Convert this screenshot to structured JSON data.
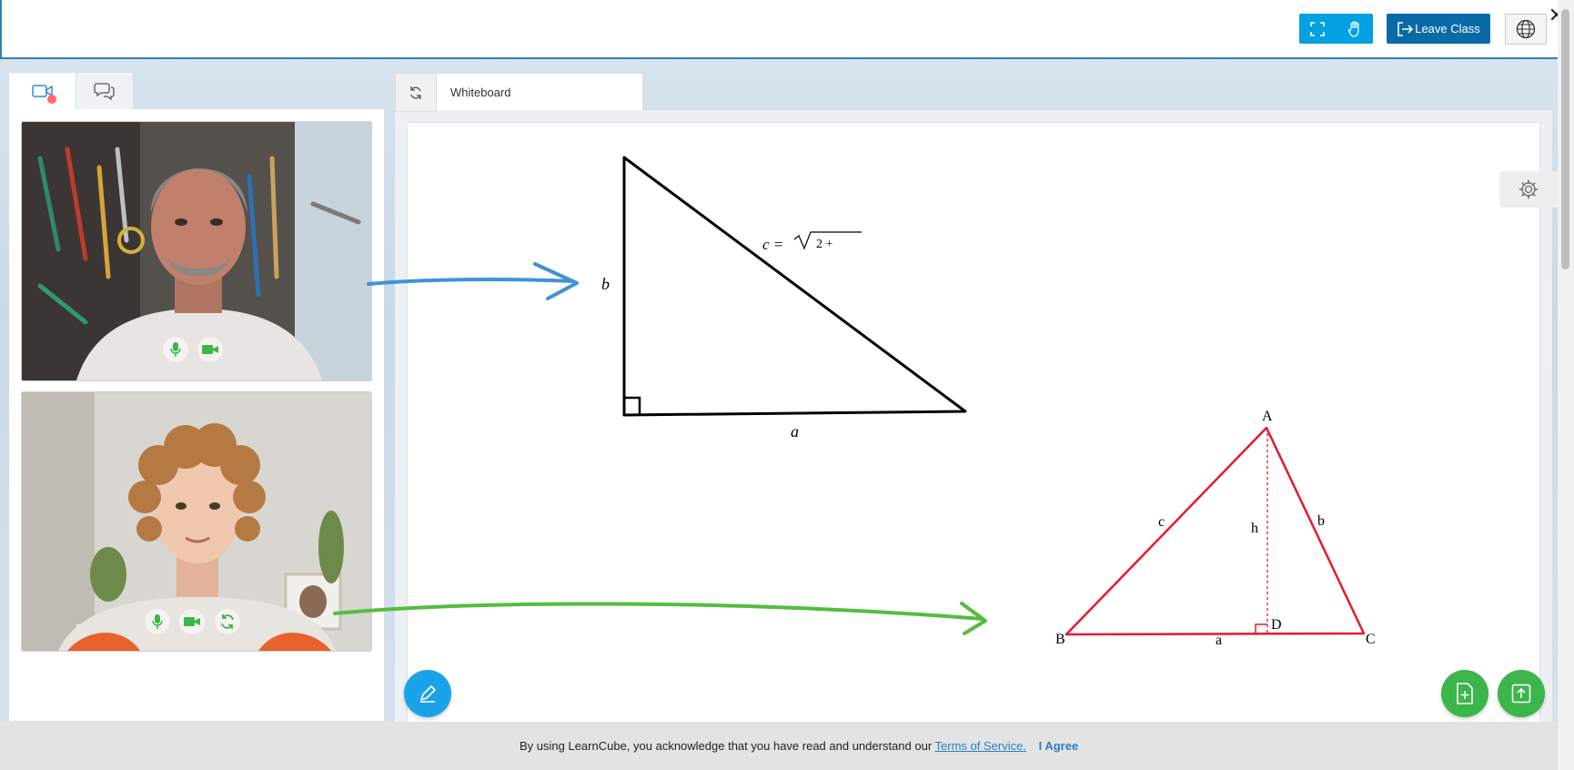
{
  "toolbar": {
    "fullscreen_icon": "fullscreen-icon",
    "raise_hand_icon": "hand-icon",
    "leave_label": "Leave Class",
    "language_icon": "globe-icon",
    "close_icon": "close-icon",
    "accent_color": "#03a0e2",
    "leave_color": "#0a6aa8"
  },
  "left_panel": {
    "tabs": [
      {
        "icon": "video-camera-icon"
      },
      {
        "icon": "chat-icon"
      }
    ],
    "participants": [
      {
        "controls": [
          "mic-icon",
          "camera-icon"
        ]
      },
      {
        "controls": [
          "mic-icon",
          "camera-icon",
          "switch-camera-icon"
        ]
      }
    ]
  },
  "whiteboard": {
    "tab_label": "Whiteboard",
    "refresh_icon": "refresh-icon",
    "settings_icon": "gear-icon",
    "right_triangle": {
      "label_b": "b",
      "label_a": "a",
      "formula_lhs": "c =",
      "formula_rhs": "2 +"
    },
    "red_triangle": {
      "vertex_a": "A",
      "vertex_b": "B",
      "vertex_c": "C",
      "vertex_d": "D",
      "side_c": "c",
      "side_b": "b",
      "side_a": "a",
      "height": "h",
      "color": "#e8192c"
    },
    "arrow_colors": {
      "blue": "#3f93d6",
      "green": "#52be3d"
    }
  },
  "fabs": {
    "pen_icon": "pen-icon",
    "add_page_icon": "add-document-icon",
    "upload_icon": "upload-icon"
  },
  "cookie_notice": {
    "text": "By using LearnCube, you acknowledge that you have read and understand our",
    "link": "Terms of Service.",
    "agree": "I Agree"
  }
}
